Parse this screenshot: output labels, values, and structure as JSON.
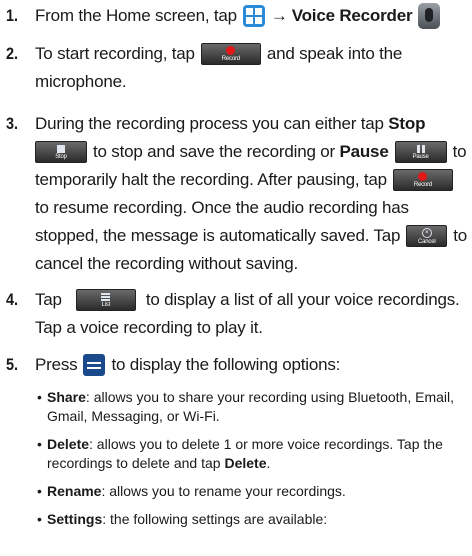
{
  "steps": [
    {
      "num": "1.",
      "t1": "From the Home screen, tap",
      "t2": "Voice Recorder",
      "apps_icon": "apps-grid-icon",
      "recorder_icon": "voice-recorder-icon"
    },
    {
      "num": "2.",
      "l1a": "To start recording, tap",
      "l1b": "and speak into the",
      "l2": "microphone.",
      "record_label": "Record"
    },
    {
      "num": "3.",
      "l1a": "During the recording process you can either tap",
      "stop_word": "Stop",
      "stop_label": "Stop",
      "l2a": "to stop and save the recording or",
      "pause_word": "Pause",
      "pause_label": "Pause",
      "l2b": "to",
      "l3a": "temporarily halt the recording. After pausing, tap",
      "record_label": "Record",
      "l4": "to resume recording. Once the audio recording has",
      "l5a": "stopped, the message is automatically saved. Tap",
      "cancel_label": "Cancel",
      "l5b": "to",
      "l6": "cancel the recording without saving."
    },
    {
      "num": "4.",
      "l1a": "Tap",
      "list_label": "List",
      "l1b": "to display a list of all your voice recordings.",
      "l2": "Tap a voice recording to play it."
    },
    {
      "num": "5.",
      "l1a": "Press",
      "l1b": "to display the following options:",
      "menu_icon": "menu-icon"
    }
  ],
  "bullets": {
    "share_term": "Share",
    "share_l1": ": allows you to share your recording using Bluetooth, Email,",
    "share_l2": "Gmail, Messaging, or Wi-Fi.",
    "delete_term": "Delete",
    "delete_l1": ": allows you to delete 1 or more voice recordings. Tap the",
    "delete_l2a": "recordings to delete and tap",
    "delete_l2b": "Delete",
    "delete_l2c": ".",
    "rename_term": "Rename",
    "rename_l1": ": allows you to rename your recordings.",
    "settings_term": "Settings",
    "settings_l1": ": the following settings are available:"
  },
  "colors": {
    "record_dot": "#e01818",
    "apps_blue": "#2a8cd8",
    "menu_blue": "#1a4a8c"
  }
}
